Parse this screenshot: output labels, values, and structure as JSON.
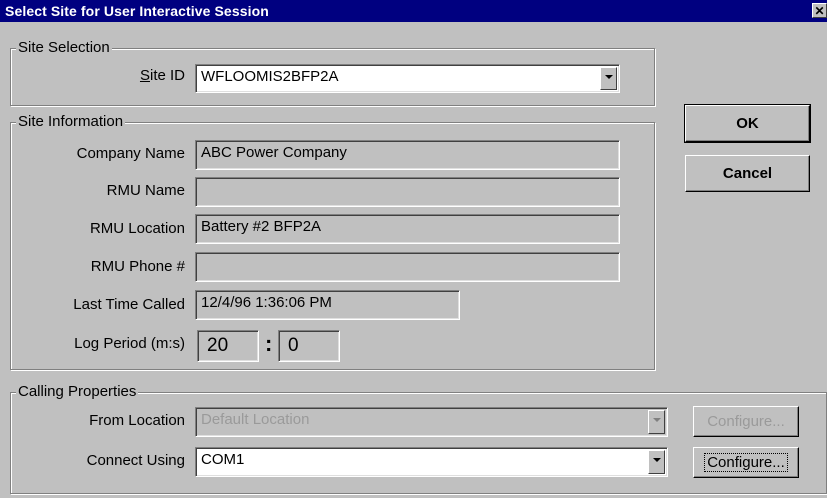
{
  "window": {
    "title": "Select Site for User Interactive Session",
    "close_glyph": "✕"
  },
  "site_selection": {
    "group_label": "Site Selection",
    "site_id_label_prefix": "S",
    "site_id_label_rest": "ite ID",
    "site_id_value": "WFLOOMIS2BFP2A"
  },
  "site_information": {
    "group_label": "Site Information",
    "company_name_label": "Company Name",
    "company_name_value": "ABC Power Company",
    "rmu_name_label": "RMU Name",
    "rmu_name_value": "",
    "rmu_location_label": "RMU Location",
    "rmu_location_value": "Battery #2 BFP2A",
    "rmu_phone_label": "RMU Phone #",
    "rmu_phone_value": "",
    "last_time_called_label": "Last Time Called",
    "last_time_called_value": "12/4/96 1:36:06 PM",
    "log_period_label": "Log Period (m:s)",
    "log_period_minutes": "20",
    "log_period_separator": ":",
    "log_period_seconds": "0"
  },
  "calling_properties": {
    "group_label": "Calling Properties",
    "from_location_label": "From Location",
    "from_location_value": "Default Location",
    "connect_using_label": "Connect Using",
    "connect_using_value": "COM1",
    "configure_label": "Configure...",
    "configure2_label": "Configure..."
  },
  "buttons": {
    "ok": "OK",
    "cancel": "Cancel"
  }
}
